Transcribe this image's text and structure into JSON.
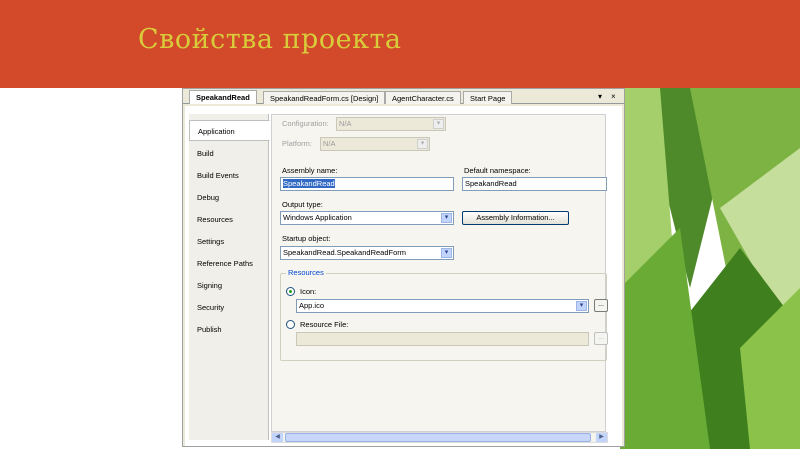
{
  "slide": {
    "title": "Свойства проекта"
  },
  "doc_tabs": [
    {
      "label": "SpeakandRead",
      "active": true
    },
    {
      "label": "SpeakandReadForm.cs [Design]",
      "active": false
    },
    {
      "label": "AgentCharacter.cs",
      "active": false
    },
    {
      "label": "Start Page",
      "active": false
    }
  ],
  "tab_controls": {
    "dropdown": "▾",
    "close": "×"
  },
  "side_tabs": [
    "Application",
    "Build",
    "Build Events",
    "Debug",
    "Resources",
    "Settings",
    "Reference Paths",
    "Signing",
    "Security",
    "Publish"
  ],
  "active_side_tab": "Application",
  "application": {
    "configuration_label": "Configuration:",
    "configuration_value": "N/A",
    "platform_label": "Platform:",
    "platform_value": "N/A",
    "assembly_name_label": "Assembly name:",
    "assembly_name_value": "SpeakandRead",
    "default_namespace_label": "Default namespace:",
    "default_namespace_value": "SpeakandRead",
    "output_type_label": "Output type:",
    "output_type_value": "Windows Application",
    "assembly_info_button": "Assembly Information...",
    "startup_object_label": "Startup object:",
    "startup_object_value": "SpeakandRead.SpeakandReadForm",
    "resources_group_label": "Resources",
    "icon_label": "Icon:",
    "icon_value": "App.ico",
    "resource_file_label": "Resource File:",
    "resource_file_value": "",
    "browse_label": "...",
    "selected_resource_option": "Icon"
  }
}
